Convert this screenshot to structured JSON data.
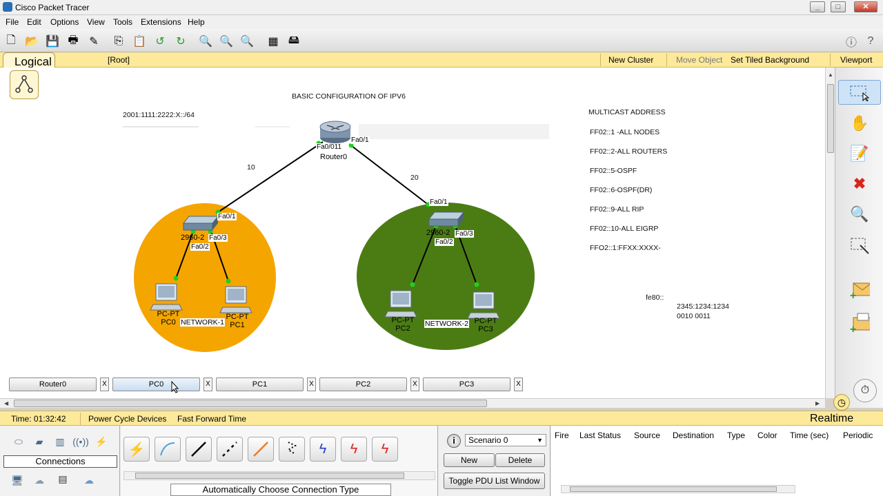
{
  "window": {
    "title": "Cisco Packet Tracer"
  },
  "menu": [
    "File",
    "Edit",
    "Options",
    "View",
    "Tools",
    "Extensions",
    "Help"
  ],
  "logical_bar": {
    "tab": "Logical",
    "root": "[Root]",
    "new_cluster": "New Cluster",
    "move_object": "Move Object",
    "set_tiled_background": "Set Tiled Background",
    "viewport": "Viewport"
  },
  "workspace": {
    "heading": "BASIC CONFIGURATION OF IPV6",
    "ipv6_prefix": "2001:1111:2222:X::/64",
    "multicast": [
      "MULTICAST ADDRESS",
      "FF02::1  -ALL NODES",
      "FF02::2-ALL ROUTERS",
      "FF02::5-OSPF",
      "FF02::6-OSPF(DR)",
      "FF02::9-ALL RIP",
      "FF02::10-ALL EIGRP",
      "FFO2::1:FFXX:XXXX-"
    ],
    "link_local": "fe80::",
    "addr_line1": "2345:1234:1234",
    "addr_line2": "0010 0011",
    "router": {
      "name": "Router0",
      "port_left": "Fa0/011",
      "port_right": "Fa0/1"
    },
    "link_left_label": "10",
    "link_right_label": "20",
    "switch_left": {
      "model": "2960-2",
      "port_up": "Fa0/1",
      "port_a": "Fa0/3",
      "port_b": "Fa0/2"
    },
    "switch_right": {
      "model": "2960-2",
      "port_up": "Fa0/1",
      "port_a": "Fa0/3",
      "port_b": "Fa0/2"
    },
    "network1": "NETWORK-1",
    "network2": "NETWORK-2",
    "pcs": [
      {
        "type": "PC-PT",
        "name": "PC0"
      },
      {
        "type": "PC-PT",
        "name": "PC1"
      },
      {
        "type": "PC-PT",
        "name": "PC2"
      },
      {
        "type": "PC-PT",
        "name": "PC3"
      }
    ],
    "colors": {
      "network1": "#f5a500",
      "network2": "#4b7c14"
    }
  },
  "pdu_tabs": [
    "Router0",
    "PC0",
    "PC1",
    "PC2",
    "PC3"
  ],
  "pdu_tab_close": "X",
  "status": {
    "time": "Time: 01:32:42",
    "power_cycle": "Power Cycle Devices",
    "fast_forward": "Fast Forward Time",
    "mode": "Realtime"
  },
  "bottom": {
    "connections_label": "Connections",
    "auto_connection": "Automatically Choose Connection Type",
    "scenario": "Scenario 0",
    "new_btn": "New",
    "delete_btn": "Delete",
    "toggle_btn": "Toggle PDU List Window",
    "pdu_columns": [
      "Fire",
      "Last Status",
      "Source",
      "Destination",
      "Type",
      "Color",
      "Time (sec)",
      "Periodic"
    ]
  }
}
